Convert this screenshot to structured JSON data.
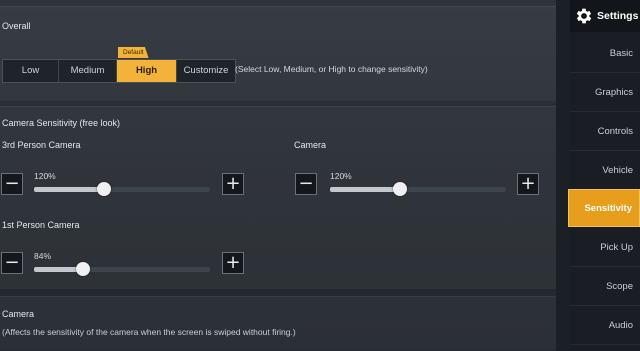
{
  "overall": {
    "title": "Overall",
    "options": [
      "Low",
      "Medium",
      "High",
      "Customize"
    ],
    "selected": "High",
    "default_badge": "Default",
    "hint": "(Select Low, Medium, or High to change sensitivity)"
  },
  "camera_free_look": {
    "title": "Camera Sensitivity (free look)",
    "third_person": {
      "label": "3rd Person Camera",
      "value_text": "120%",
      "level": 0.4
    },
    "camera": {
      "label": "Camera",
      "value_text": "120%",
      "level": 0.4
    },
    "first_person": {
      "label": "1st Person Camera",
      "value_text": "84%",
      "level": 0.28
    }
  },
  "camera_section": {
    "title": "Camera",
    "description": "(Affects the sensitivity of the camera when the screen is swiped without firing.)"
  },
  "buttons": {
    "minus": "−",
    "plus": "+"
  },
  "sidebar": {
    "title": "Settings",
    "items": [
      "Basic",
      "Graphics",
      "Controls",
      "Vehicle",
      "Sensitivity",
      "Pick Up",
      "Scope",
      "Audio"
    ],
    "active": "Sensitivity"
  },
  "colors": {
    "accent": "#f3b23a",
    "active_tab": "#e79e1d"
  },
  "icons": {
    "settings": "gear-icon"
  }
}
